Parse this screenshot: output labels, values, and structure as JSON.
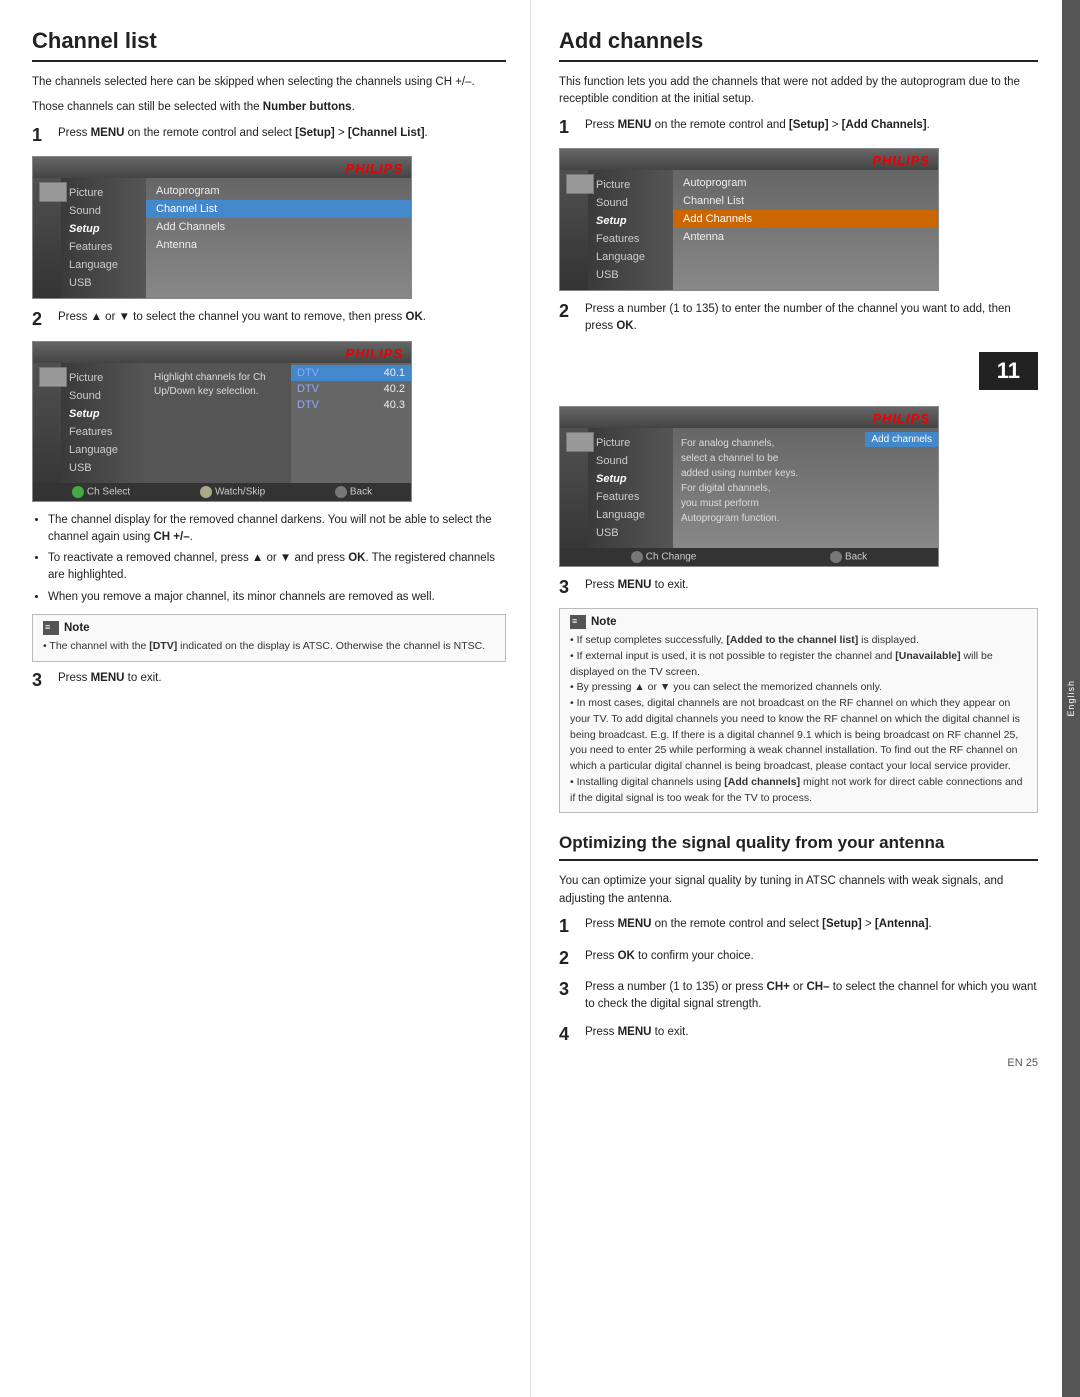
{
  "side_tab": {
    "text": "English"
  },
  "left_col": {
    "title": "Channel list",
    "intro": [
      "The channels selected here can be skipped when selecting the channels using CH +/–.",
      "Those channels can still be selected with the Number buttons."
    ],
    "step1": {
      "num": "1",
      "text": "Press MENU on the remote control and select [Setup] > [Channel List]."
    },
    "menu1": {
      "philips": "PHILIPS",
      "left_items": [
        "Picture",
        "Sound",
        "Setup",
        "Features",
        "Language",
        "USB"
      ],
      "right_items": [
        "Autoprogram",
        "Channel List",
        "Add Channels",
        "Antenna"
      ],
      "highlighted_right": "Channel List",
      "active_left": "Setup"
    },
    "step2": {
      "num": "2",
      "text": "Press ▲ or ▼ to select the channel you want to remove, then press OK."
    },
    "menu2": {
      "philips": "PHILIPS",
      "left_items": [
        "Picture",
        "Sound",
        "Setup",
        "Features",
        "Language",
        "USB"
      ],
      "mid_hint": "Highlight channels for Ch Up/Down key selection.",
      "dtv_items": [
        {
          "label": "DTV",
          "num": "40.1",
          "selected": true
        },
        {
          "label": "DTV",
          "num": "40.2",
          "selected": false
        },
        {
          "label": "DTV",
          "num": "40.3",
          "selected": false
        }
      ],
      "bottom_bar": [
        {
          "icon": "green",
          "label": "Ch Select"
        },
        {
          "icon": "yellow",
          "label": "Watch/Skip"
        },
        {
          "icon": "gray",
          "label": "Back"
        }
      ],
      "active_left": "Setup"
    },
    "bullets": [
      "The channel display for the removed channel darkens. You will not be able to select the channel again using CH +/–.",
      "To reactivate a removed channel, press ▲ or ▼ and press OK. The registered channels are highlighted.",
      "When you remove a major channel, its minor channels are removed as well."
    ],
    "note": {
      "label": "Note",
      "text": "The channel with the [DTV] indicated on the display is ATSC. Otherwise the channel is NTSC."
    },
    "step3": {
      "num": "3",
      "text": "Press MENU to exit."
    }
  },
  "right_col": {
    "title": "Add channels",
    "intro": "This function lets you add the channels that were not added by the autoprogram due to the receptible condition at the initial setup.",
    "step1": {
      "num": "1",
      "text": "Press MENU on the remote control and [Setup] > [Add Channels]."
    },
    "menu1": {
      "philips": "PHILIPS",
      "left_items": [
        "Picture",
        "Sound",
        "Setup",
        "Features",
        "Language",
        "USB"
      ],
      "right_items": [
        "Autoprogram",
        "Channel List",
        "Add Channels",
        "Antenna"
      ],
      "highlighted_right": "Add Channels",
      "active_left": "Setup"
    },
    "step2": {
      "num": "2",
      "text": "Press a number (1 to 135) to enter the number of the channel you want to add, then press OK."
    },
    "number_badge": "11",
    "menu2": {
      "philips": "PHILIPS",
      "left_items": [
        "Picture",
        "Sound",
        "Setup",
        "Features",
        "Language",
        "USB"
      ],
      "add_channels_label": "Add channels",
      "analog_text": "For analog channels, select a channel to be added using number keys.\nFor digital channels, you must perform Autoprogram function.",
      "bottom_bar": [
        {
          "icon": "gray",
          "label": "Ch Change"
        },
        {
          "icon": "gray",
          "label": "Back"
        }
      ],
      "active_left": "Setup"
    },
    "step3": {
      "num": "3",
      "text": "Press MENU to exit."
    },
    "note": {
      "label": "Note",
      "lines": [
        "If setup completes successfully, [Added to the channel list] is displayed.",
        "If external input is used, it is not possible to register the channel and [Unavailable] will be displayed on the TV screen.",
        "By pressing ▲ or ▼ you can select the memorized channels only.",
        "In most cases, digital channels are not broadcast on the RF channel on which they appear on your TV. To add digital channels you need to know the RF channel on which the digital channel is being broadcast. E.g. If there is a digital channel 9.1 which is being broadcast on RF channel 25, you need to enter 25 while performing a weak channel installation. To find out the RF channel on which a particular digital channel is being broadcast, please contact your local service provider.",
        "Installing digital channels using [Add channels] might not work for direct cable connections and if the digital signal is too weak for the TV to process."
      ]
    },
    "optimizing": {
      "title": "Optimizing the signal quality from your antenna",
      "intro": "You can optimize your signal quality by tuning in ATSC channels with weak signals, and adjusting the antenna.",
      "steps": [
        {
          "num": "1",
          "text": "Press MENU on the remote control and select [Setup] > [Antenna]."
        },
        {
          "num": "2",
          "text": "Press OK to confirm your choice."
        },
        {
          "num": "3",
          "text": "Press a number (1 to 135) or press CH+ or CH– to select the channel for which you want to check the digital signal strength."
        },
        {
          "num": "4",
          "text": "Press MENU to exit."
        }
      ]
    },
    "page_num": "EN   25"
  }
}
